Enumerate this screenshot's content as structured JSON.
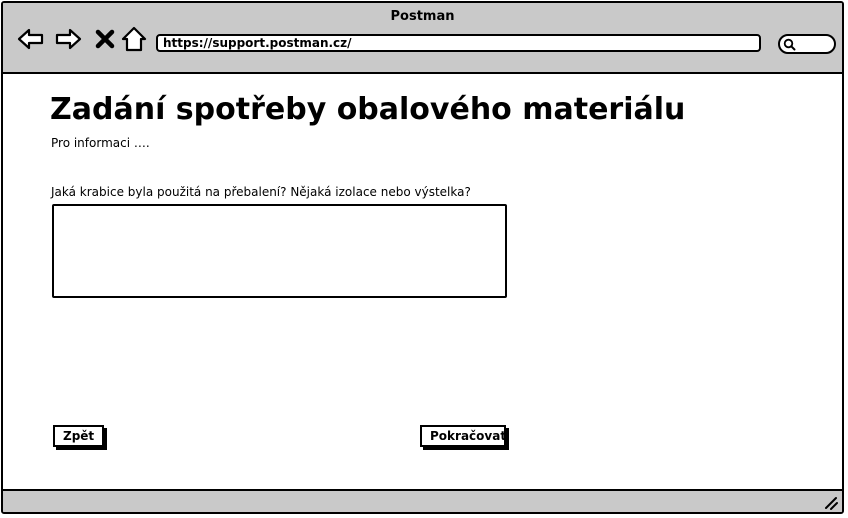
{
  "window": {
    "title": "Postman"
  },
  "toolbar": {
    "back_icon": "arrow-left-icon",
    "forward_icon": "arrow-right-icon",
    "stop_icon": "close-icon",
    "home_icon": "home-icon",
    "url": "https://support.postman.cz/",
    "search_icon": "search-icon"
  },
  "page": {
    "title": "Zadání spotřeby obalového materiálu",
    "info": "Pro informaci ….",
    "question": "Jaká krabice byla použitá na přebalení? Nějaká izolace nebo výstelka?",
    "answer_value": ""
  },
  "buttons": {
    "back_label": "Zpět",
    "continue_label": "Pokračovat"
  },
  "colors": {
    "chrome": "#c9c9c9",
    "background": "#ffffff",
    "stroke": "#000000"
  }
}
